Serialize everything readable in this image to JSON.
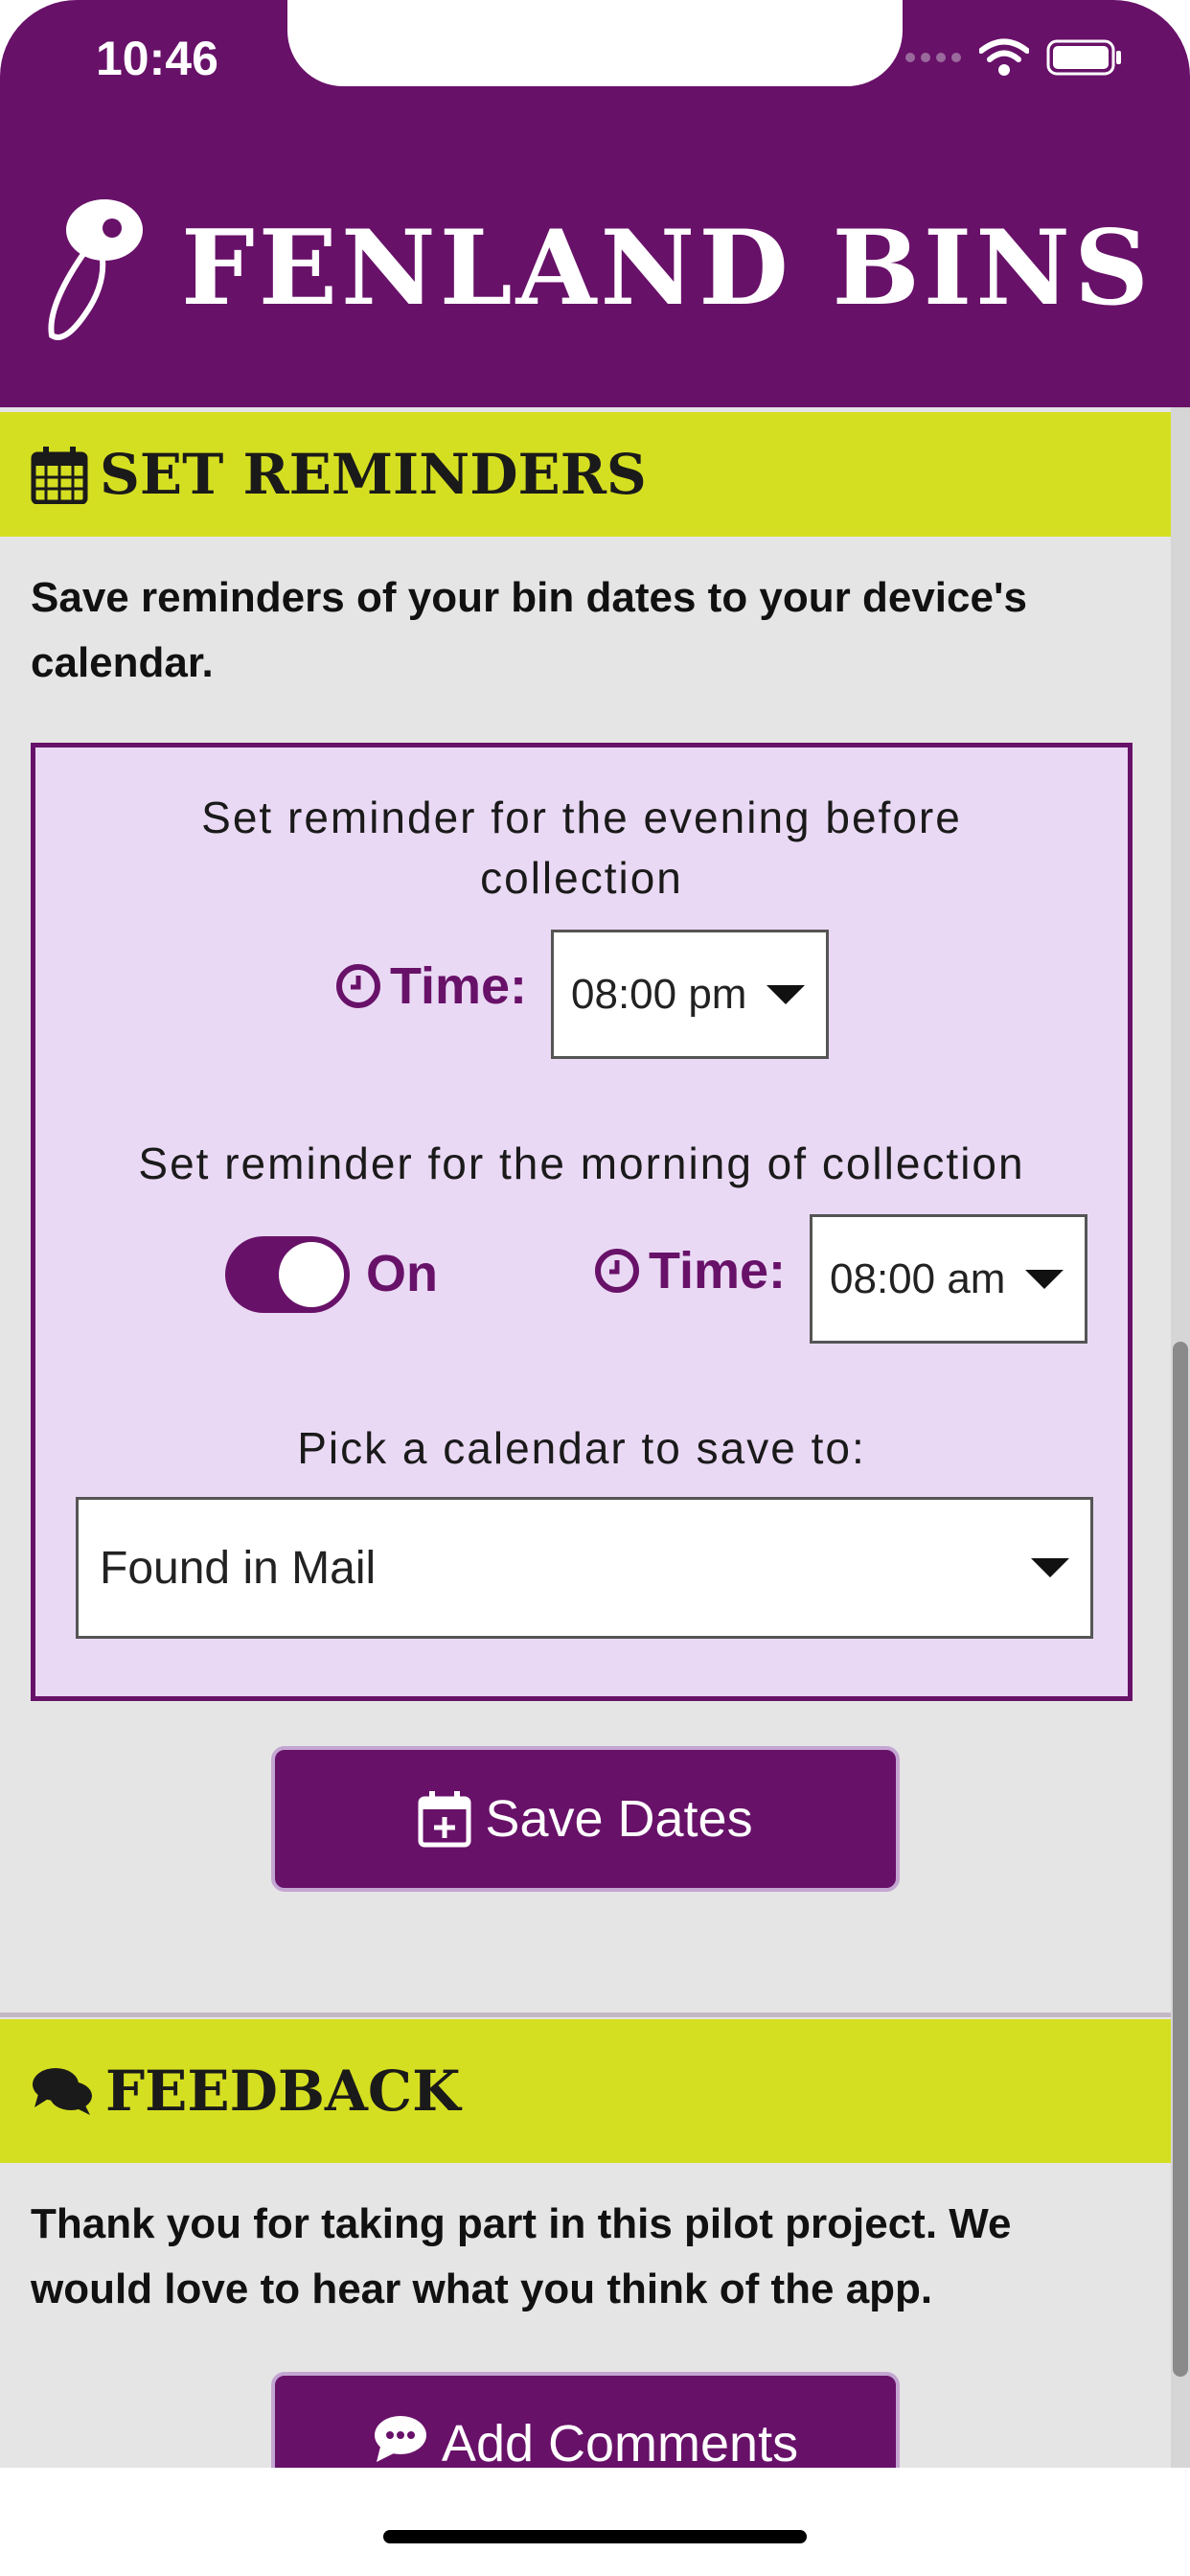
{
  "status_bar": {
    "time": "10:46"
  },
  "header": {
    "brand": "FENLAND BINS"
  },
  "reminders": {
    "title": "SET REMINDERS",
    "description": "Save reminders of your bin dates to your device's calendar.",
    "evening_text": "Set reminder for the evening before collection",
    "evening_time_label": "Time:",
    "evening_time_value": "08:00 pm",
    "morning_text": "Set reminder for the morning of collection",
    "morning_toggle_label": "On",
    "morning_toggle_on": true,
    "morning_time_label": "Time:",
    "morning_time_value": "08:00 am",
    "calendar_prompt": "Pick a calendar to save to:",
    "calendar_value": "Found in Mail",
    "save_button": "Save Dates"
  },
  "feedback": {
    "title": "FEEDBACK",
    "description": "Thank you for taking part in this pilot project. We would love to hear what you think of the app.",
    "comments_button": "Add Comments"
  },
  "colors": {
    "brand_purple": "#681169",
    "accent_yellow": "#d5df21",
    "panel_lilac": "#ead9f4"
  }
}
